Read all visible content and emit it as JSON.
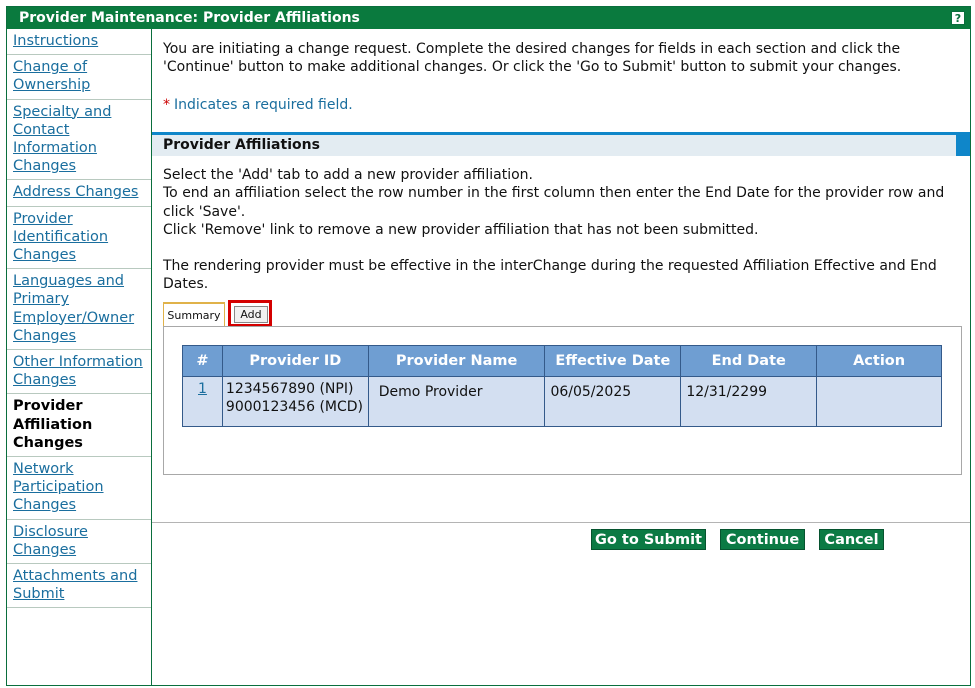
{
  "window": {
    "title": "Provider Maintenance: Provider Affiliations",
    "help_label": "?"
  },
  "sidebar": {
    "items": [
      {
        "label": "Instructions",
        "active": false
      },
      {
        "label": "Change of Ownership",
        "active": false
      },
      {
        "label": "Specialty and Contact Information Changes",
        "active": false
      },
      {
        "label": "Address Changes",
        "active": false
      },
      {
        "label": "Provider Identification Changes",
        "active": false
      },
      {
        "label": "Languages and Primary Employer/Owner Changes",
        "active": false
      },
      {
        "label": "Other Information Changes",
        "active": false
      },
      {
        "label": "Provider Affiliation Changes",
        "active": true
      },
      {
        "label": "Network Participation Changes",
        "active": false
      },
      {
        "label": "Disclosure Changes",
        "active": false
      },
      {
        "label": "Attachments and Submit",
        "active": false
      }
    ]
  },
  "content": {
    "intro": "You are initiating a change request. Complete the desired changes for fields in each section and click the 'Continue' button to make additional changes. Or click the 'Go to Submit' button to submit your changes.",
    "required_star": "*",
    "required_note": "Indicates a required field.",
    "section_title": "Provider Affiliations",
    "instructions": {
      "line1": "Select the 'Add' tab to add a new provider affiliation.",
      "line2": "To end an affiliation select the row number in the first column then enter the End Date for the provider row and click 'Save'.",
      "line3": "Click 'Remove' link to remove a new provider affiliation that has not been submitted.",
      "line4": "The rendering provider must be effective in the interChange during the requested Affiliation Effective and End Dates."
    },
    "tabs": {
      "summary": "Summary",
      "add": "Add"
    },
    "table": {
      "headers": {
        "num": "#",
        "provider_id": "Provider ID",
        "provider_name": "Provider Name",
        "effective_date": "Effective Date",
        "end_date": "End Date",
        "action": "Action"
      },
      "rows": [
        {
          "num": "1",
          "provider_id_line1": "1234567890 (NPI)",
          "provider_id_line2": "9000123456 (MCD)",
          "provider_name": "Demo Provider",
          "effective_date": "06/05/2025",
          "end_date": "12/31/2299",
          "action": ""
        }
      ]
    }
  },
  "buttons": {
    "go_to_submit": "Go to Submit",
    "continue": "Continue",
    "cancel": "Cancel"
  },
  "colors": {
    "title_bar": "#0a7a3e",
    "section_accent": "#0f86c9",
    "table_header": "#6f9ed2",
    "table_row": "#d3dff1",
    "highlight_box": "#d40000",
    "button": "#0b7a44"
  }
}
